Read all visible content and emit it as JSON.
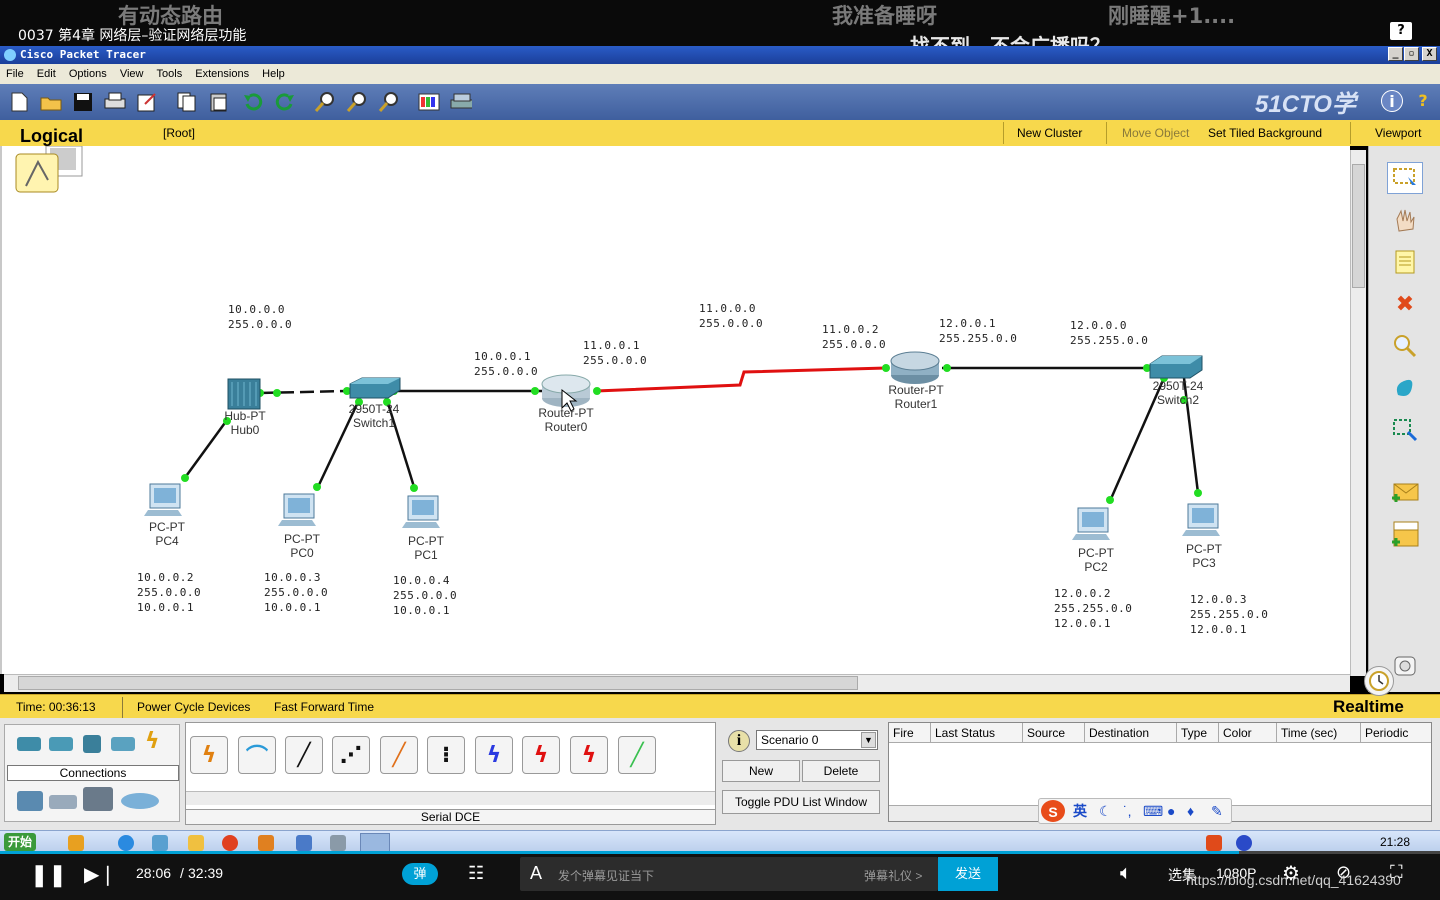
{
  "video": {
    "title": "0037 第4章 网络层–验证网络层功能",
    "danmaku": [
      "有动态路由",
      "我准备睡呀",
      "刚睡醒+1....",
      "找不到，不会广播吗？"
    ],
    "help_label": "?",
    "time_current": "28:06",
    "time_separator": "/",
    "time_total": "32:39",
    "danmaku_toggle": "弹",
    "danmaku_input_placeholder": "发个弹幕见证当下",
    "danmaku_etiquette": "弹幕礼仪 >",
    "send_label": "发送",
    "quality_select": "选集",
    "resolution": "1080P",
    "watermark": "https://blog.csdn.net/qq_41624390"
  },
  "window": {
    "title": "Cisco Packet Tracer",
    "controls": [
      "_",
      "▫",
      "X"
    ]
  },
  "menu": [
    "File",
    "Edit",
    "Options",
    "View",
    "Tools",
    "Extensions",
    "Help"
  ],
  "toolbar": {
    "brand": "51CTO学院",
    "icons": [
      "new-icon",
      "open-icon",
      "save-icon",
      "print-icon",
      "wizard-icon",
      "copy-icon",
      "paste-icon",
      "undo-icon",
      "redo-icon",
      "zoom-in-icon",
      "zoom-reset-icon",
      "zoom-out-icon",
      "palette-icon",
      "custom-device-icon"
    ]
  },
  "logical_bar": {
    "title": "Logical",
    "root": "[Root]",
    "new_cluster": "New Cluster",
    "move_object": "Move Object",
    "set_tiled_background": "Set Tiled Background",
    "viewport": "Viewport"
  },
  "topology": {
    "devices": [
      {
        "id": "hub0",
        "type": "Hub-PT",
        "name": "Hub0"
      },
      {
        "id": "switch1",
        "type": "2950T-24",
        "name": "Switch1"
      },
      {
        "id": "router0",
        "type": "Router-PT",
        "name": "Router0"
      },
      {
        "id": "router1",
        "type": "Router-PT",
        "name": "Router1"
      },
      {
        "id": "switch2",
        "type": "2950T-24",
        "name": "Switch2"
      },
      {
        "id": "pc4",
        "type": "PC-PT",
        "name": "PC4"
      },
      {
        "id": "pc0",
        "type": "PC-PT",
        "name": "PC0"
      },
      {
        "id": "pc1",
        "type": "PC-PT",
        "name": "PC1"
      },
      {
        "id": "pc2",
        "type": "PC-PT",
        "name": "PC2"
      },
      {
        "id": "pc3",
        "type": "PC-PT",
        "name": "PC3"
      }
    ],
    "notes": [
      {
        "id": "net10",
        "text": "10.0.0.0\n255.0.0.0"
      },
      {
        "id": "r0e",
        "text": "10.0.0.1\n255.0.0.0"
      },
      {
        "id": "r0s",
        "text": "11.0.0.1\n255.0.0.0"
      },
      {
        "id": "net11",
        "text": "11.0.0.0\n255.0.0.0"
      },
      {
        "id": "r1s",
        "text": "11.0.0.2\n255.0.0.0"
      },
      {
        "id": "r1e",
        "text": "12.0.0.1\n255.255.0.0"
      },
      {
        "id": "net12",
        "text": "12.0.0.0\n255.255.0.0"
      },
      {
        "id": "pc4ip",
        "text": "10.0.0.2\n255.0.0.0\n10.0.0.1"
      },
      {
        "id": "pc0ip",
        "text": "10.0.0.3\n255.0.0.0\n10.0.0.1"
      },
      {
        "id": "pc1ip",
        "text": "10.0.0.4\n255.0.0.0\n10.0.0.1"
      },
      {
        "id": "pc2ip",
        "text": "12.0.0.2\n255.255.0.0\n12.0.0.1"
      },
      {
        "id": "pc3ip",
        "text": "12.0.0.3\n255.255.0.0\n12.0.0.1"
      }
    ],
    "link_colors": {
      "ethernet": "#111111",
      "serial": "#e01010",
      "port_up": "#22dd22"
    }
  },
  "status_bar": {
    "time_label": "Time: 00:36:13",
    "power_cycle": "Power Cycle Devices",
    "fast_forward": "Fast Forward Time",
    "mode": "Realtime"
  },
  "bottom_panel": {
    "category_label": "Connections",
    "selected_connection": "Serial DCE",
    "scenario": "Scenario 0",
    "new_label": "New",
    "delete_label": "Delete",
    "toggle_pdu": "Toggle PDU List Window",
    "pdu_columns": [
      "Fire",
      "Last Status",
      "Source",
      "Destination",
      "Type",
      "Color",
      "Time (sec)",
      "Periodic"
    ]
  },
  "taskbar": {
    "start": "开始",
    "ime": "英",
    "clock": "21:28"
  }
}
